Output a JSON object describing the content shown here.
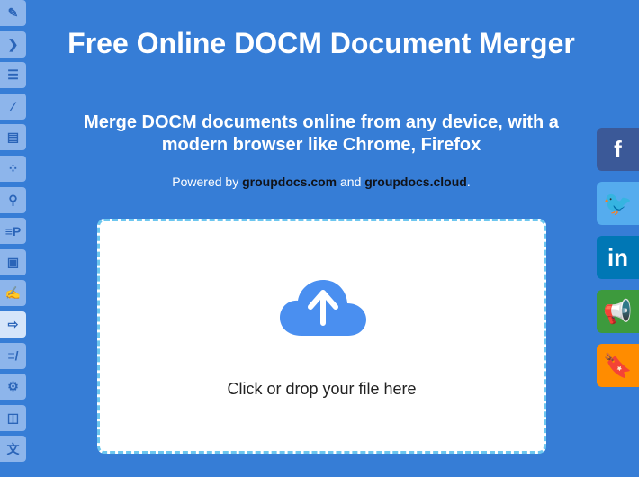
{
  "sidebar": {
    "items": [
      "edit-annotate",
      "chevron-right",
      "viewer",
      "signature",
      "document-frame",
      "redaction",
      "search",
      "parser",
      "image",
      "editor",
      "merger",
      "watermark",
      "diagram",
      "compare",
      "translate"
    ],
    "active_index": 10
  },
  "header": {
    "title": "Free Online DOCM Document Merger",
    "subtitle": "Merge DOCM documents online from any device, with a modern browser like Chrome, Firefox"
  },
  "powered": {
    "prefix": "Powered by ",
    "link1": "groupdocs.com",
    "middle": " and ",
    "link2": "groupdocs.cloud",
    "suffix": "."
  },
  "upload": {
    "label": "Click or drop your file here"
  },
  "share": [
    {
      "name": "facebook",
      "glyph": "f",
      "color": "#3b5998"
    },
    {
      "name": "twitter",
      "glyph": "🐦",
      "color": "#55acee"
    },
    {
      "name": "linkedin",
      "glyph": "in",
      "color": "#0077b5"
    },
    {
      "name": "announce",
      "glyph": "📢",
      "color": "#3d9a3d"
    },
    {
      "name": "bookmark",
      "glyph": "🔖",
      "color": "#ff8c00"
    }
  ],
  "colors": {
    "background": "#367dd6",
    "accent": "#4a8ff0"
  }
}
